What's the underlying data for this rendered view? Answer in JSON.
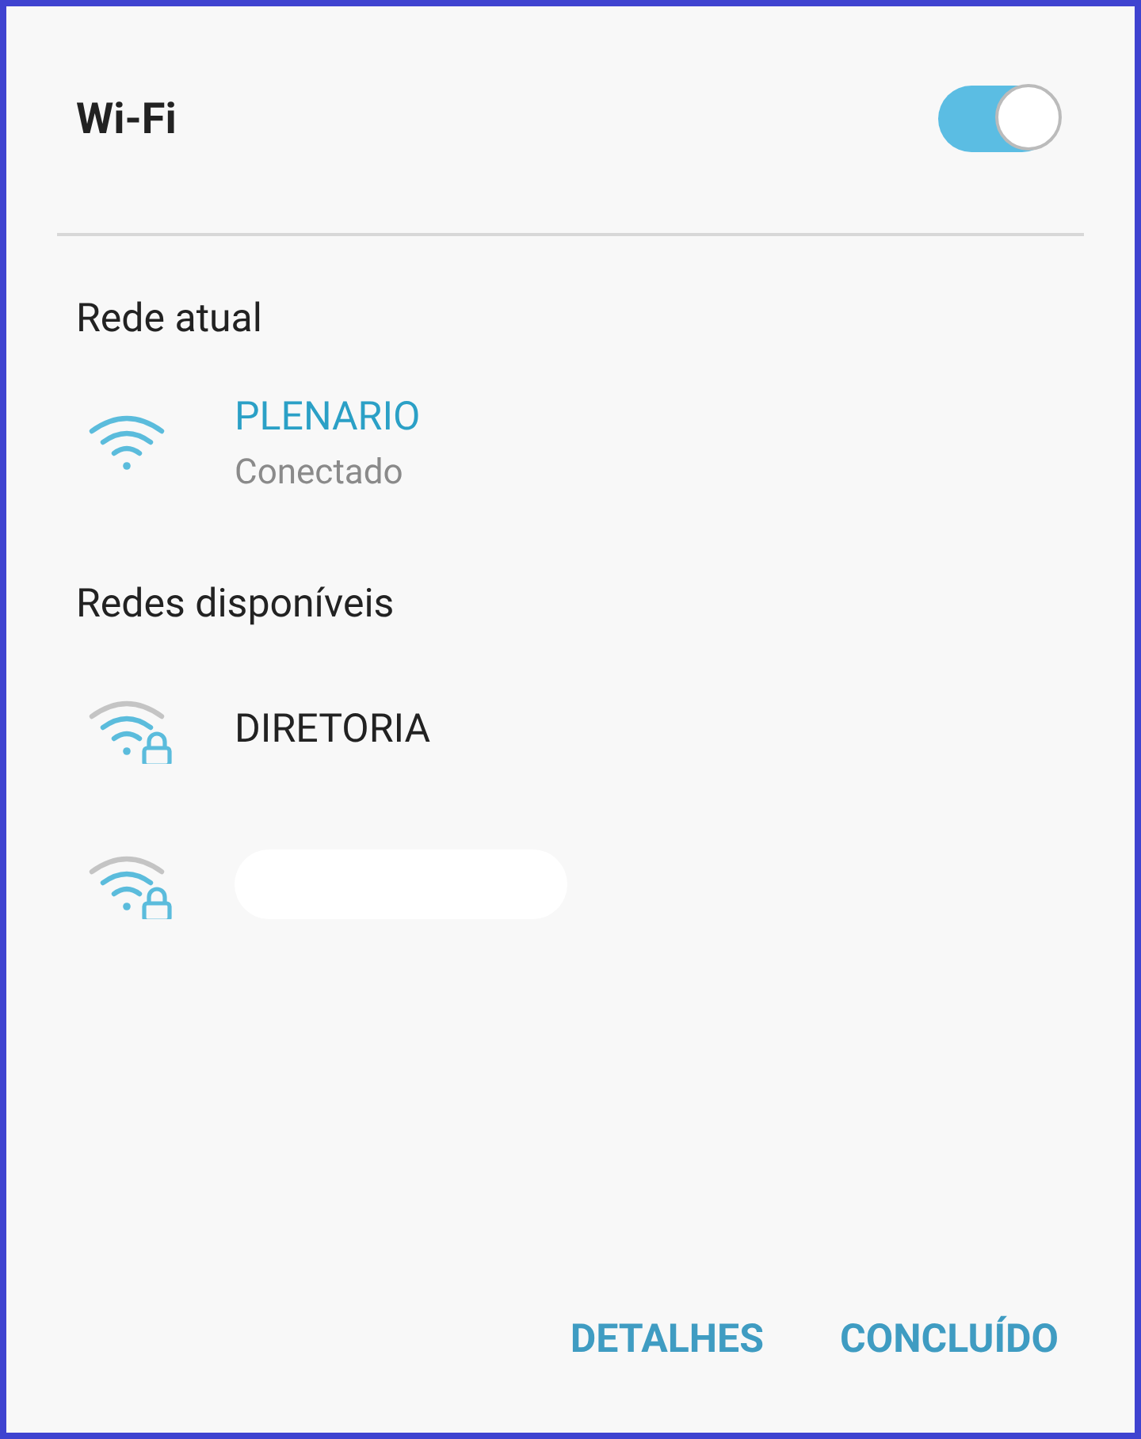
{
  "header": {
    "title": "Wi-Fi",
    "switch_on": true
  },
  "sections": [
    {
      "heading": "Rede atual",
      "networks": [
        {
          "name": "PLENARIO",
          "status": "Conectado",
          "connected": true,
          "locked": false
        }
      ]
    },
    {
      "heading": "Redes disponíveis",
      "networks": [
        {
          "name": "DIRETORIA",
          "connected": false,
          "locked": true
        },
        {
          "kind": "redacted",
          "locked": true
        }
      ]
    }
  ],
  "buttons": [
    "DETALHES",
    "CONCLUÍDO"
  ]
}
